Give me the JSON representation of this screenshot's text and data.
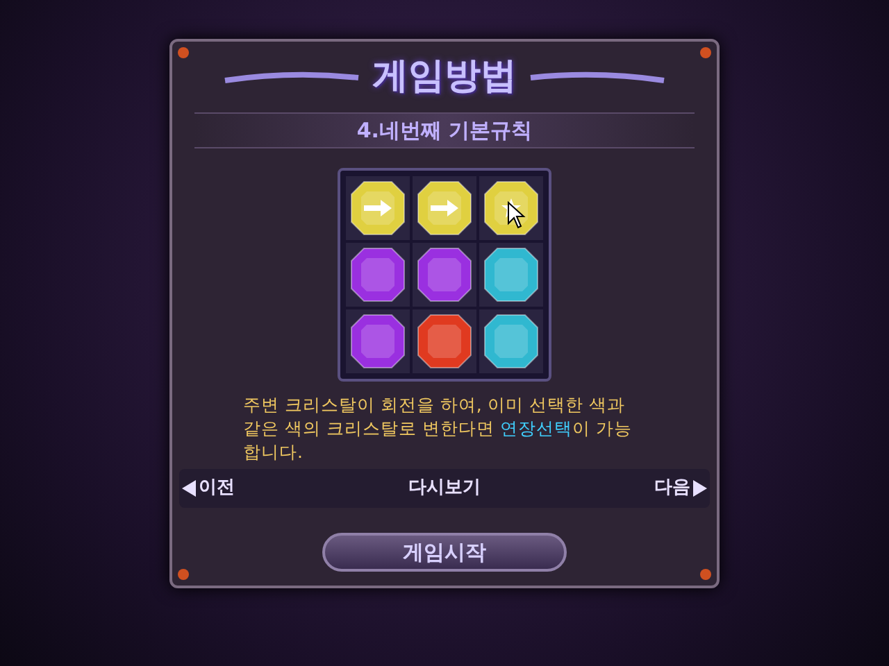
{
  "title": "게임방법",
  "subtitle": "4.네번째 기본규칙",
  "board": {
    "gems": [
      {
        "color": "#e0d040",
        "kind": "arrow"
      },
      {
        "color": "#e0d040",
        "kind": "arrow"
      },
      {
        "color": "#e0d040",
        "kind": "star"
      },
      {
        "color": "#9a30e0",
        "kind": "plain"
      },
      {
        "color": "#9a30e0",
        "kind": "plain"
      },
      {
        "color": "#30b8d0",
        "kind": "plain"
      },
      {
        "color": "#9a30e0",
        "kind": "plain"
      },
      {
        "color": "#e03a20",
        "kind": "plain"
      },
      {
        "color": "#30b8d0",
        "kind": "plain"
      }
    ]
  },
  "description": [
    {
      "text": "주변 크리스탈이 회전을 하여, 이미 선택한 색과 같은 색의 크리스탈로 변한다면 ",
      "kind": "normal"
    },
    {
      "text": "연장선택",
      "kind": "highlight"
    },
    {
      "text": "이 가능합니다.",
      "kind": "normal"
    }
  ],
  "nav": {
    "prev": "이전",
    "replay": "다시보기",
    "next": "다음"
  },
  "start_button": "게임시작"
}
